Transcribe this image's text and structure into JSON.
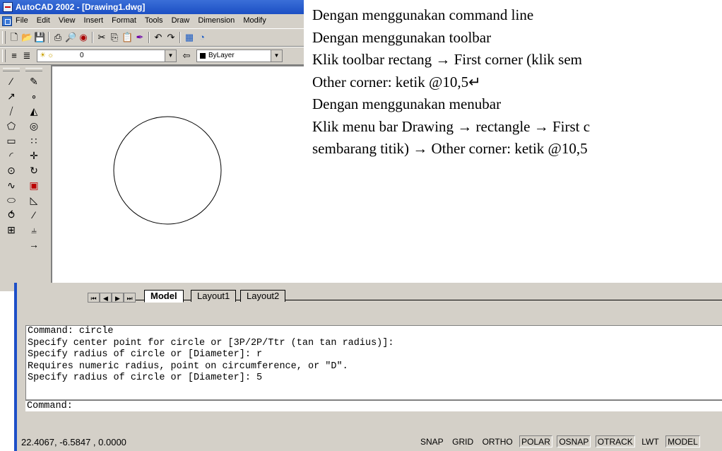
{
  "window": {
    "title": "AutoCAD 2002 - [Drawing1.dwg]"
  },
  "menu": [
    "File",
    "Edit",
    "View",
    "Insert",
    "Format",
    "Tools",
    "Draw",
    "Dimension",
    "Modify"
  ],
  "layer_toolbar": {
    "layer_value": "0",
    "color_value": "ByLayer"
  },
  "right_text": [
    "Dengan menggunakan command line",
    "Dengan menggunakan toolbar",
    "Klik toolbar rectang →  First corner (klik sem",
    "Other corner: ketik @10,5↵",
    "Dengan menggunakan menubar",
    "Klik menu bar Drawing → rectangle → First c",
    "sembarang titik) → Other corner: ketik @10,5"
  ],
  "tabs": {
    "model": "Model",
    "layout1": "Layout1",
    "layout2": "Layout2"
  },
  "command_history": [
    "Command: circle",
    "Specify center point for circle or [3P/2P/Ttr (tan tan radius)]:",
    "Specify radius of circle or [Diameter]: r",
    "Requires numeric radius, point on circumference, or \"D\".",
    "Specify radius of circle or [Diameter]: 5"
  ],
  "command_prompt": "Command:",
  "status": {
    "coords": "22.4067, -6.5847 , 0.0000",
    "buttons": [
      {
        "label": "SNAP",
        "on": false
      },
      {
        "label": "GRID",
        "on": false
      },
      {
        "label": "ORTHO",
        "on": false
      },
      {
        "label": "POLAR",
        "on": true
      },
      {
        "label": "OSNAP",
        "on": true
      },
      {
        "label": "OTRACK",
        "on": true
      },
      {
        "label": "LWT",
        "on": false
      },
      {
        "label": "MODEL",
        "on": true
      }
    ]
  }
}
